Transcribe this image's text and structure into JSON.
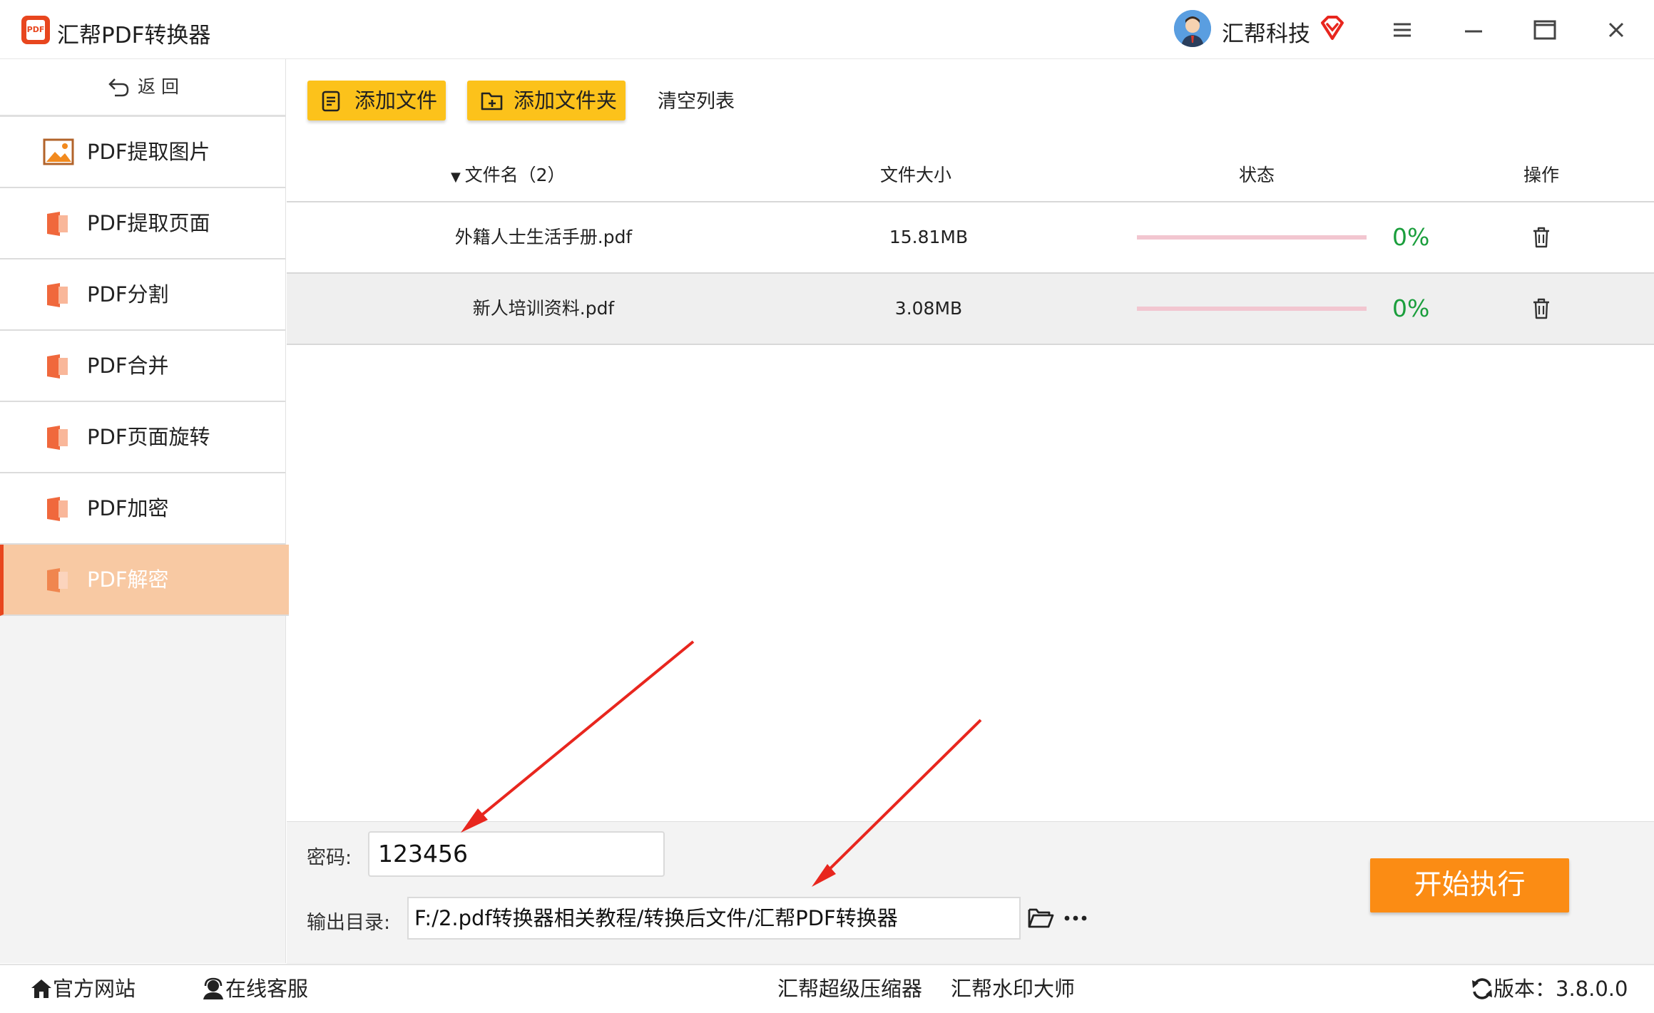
{
  "app": {
    "title": "汇帮PDF转换器",
    "logo_text": "PDF"
  },
  "account": {
    "name": "汇帮科技"
  },
  "colors": {
    "accent": "#fb8c14",
    "toolbar_button": "#fcc21b",
    "active_item": "#f8c9a3",
    "progress_text": "#1a9e3c",
    "annotation_arrow": "#e8261e"
  },
  "sidebar": {
    "back_label": "返 回",
    "items": [
      {
        "label": "PDF提取图片",
        "icon": "image-icon",
        "active": false
      },
      {
        "label": "PDF提取页面",
        "icon": "pdf-file-icon",
        "active": false
      },
      {
        "label": "PDF分割",
        "icon": "pdf-file-icon",
        "active": false
      },
      {
        "label": "PDF合并",
        "icon": "pdf-file-icon",
        "active": false
      },
      {
        "label": "PDF页面旋转",
        "icon": "pdf-file-icon",
        "active": false
      },
      {
        "label": "PDF加密",
        "icon": "pdf-file-icon",
        "active": false
      },
      {
        "label": "PDF解密",
        "icon": "pdf-file-icon",
        "active": true
      }
    ]
  },
  "toolbar": {
    "add_file": "添加文件",
    "add_folder": "添加文件夹",
    "clear_list": "清空列表"
  },
  "table": {
    "headers": {
      "name": "文件名（2）",
      "size": "文件大小",
      "status": "状态",
      "action": "操作"
    },
    "rows": [
      {
        "name": "外籍人士生活手册.pdf",
        "size": "15.81MB",
        "progress": "0%"
      },
      {
        "name": "新人培训资料.pdf",
        "size": "3.08MB",
        "progress": "0%"
      }
    ]
  },
  "options": {
    "password_label": "密码:",
    "password_value": "123456",
    "output_label": "输出目录:",
    "output_path": "F:/2.pdf转换器相关教程/转换后文件/汇帮PDF转换器",
    "start_button": "开始执行"
  },
  "footer": {
    "website": "官方网站",
    "support": "在线客服",
    "compressor": "汇帮超级压缩器",
    "watermark": "汇帮水印大师",
    "version": "版本：3.8.0.0"
  }
}
